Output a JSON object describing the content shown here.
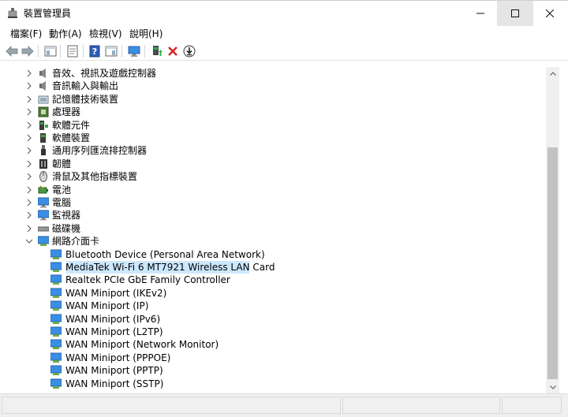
{
  "window": {
    "title": "裝置管理員",
    "icon": "device-manager-icon"
  },
  "menu": [
    {
      "label": "檔案(F)"
    },
    {
      "label": "動作(A)"
    },
    {
      "label": "檢視(V)"
    },
    {
      "label": "說明(H)"
    }
  ],
  "toolbar": [
    {
      "name": "back-button",
      "icon": "arrow-left-icon"
    },
    {
      "name": "forward-button",
      "icon": "arrow-right-icon"
    },
    {
      "name": "show-hide-console-tree-button",
      "icon": "console-tree-icon"
    },
    {
      "name": "properties-button",
      "icon": "properties-icon"
    },
    {
      "name": "help-button",
      "icon": "help-icon"
    },
    {
      "name": "show-action-pane-button",
      "icon": "action-pane-icon"
    },
    {
      "name": "scan-hardware-button",
      "icon": "monitor-scan-icon"
    },
    {
      "name": "update-driver-button",
      "icon": "update-driver-icon"
    },
    {
      "name": "uninstall-device-button",
      "icon": "red-x-icon"
    },
    {
      "name": "download-button",
      "icon": "download-circle-icon"
    }
  ],
  "tree": {
    "categories": [
      {
        "label": "音效、視訊及遊戲控制器",
        "icon": "speaker-icon",
        "expanded": false
      },
      {
        "label": "音訊輸入與輸出",
        "icon": "speaker-icon",
        "expanded": false
      },
      {
        "label": "記憶體技術裝置",
        "icon": "memory-card-icon",
        "expanded": false
      },
      {
        "label": "處理器",
        "icon": "cpu-icon",
        "expanded": false
      },
      {
        "label": "軟體元件",
        "icon": "software-component-icon",
        "expanded": false
      },
      {
        "label": "軟體裝置",
        "icon": "software-device-icon",
        "expanded": false
      },
      {
        "label": "通用序列匯流排控制器",
        "icon": "usb-icon",
        "expanded": false
      },
      {
        "label": "韌體",
        "icon": "firmware-icon",
        "expanded": false
      },
      {
        "label": "滑鼠及其他指標裝置",
        "icon": "mouse-icon",
        "expanded": false
      },
      {
        "label": "電池",
        "icon": "battery-icon",
        "expanded": false
      },
      {
        "label": "電腦",
        "icon": "computer-icon",
        "expanded": false
      },
      {
        "label": "監視器",
        "icon": "monitor-icon",
        "expanded": false
      },
      {
        "label": "磁碟機",
        "icon": "disk-drive-icon",
        "expanded": false
      },
      {
        "label": "網路介面卡",
        "icon": "network-adapter-icon",
        "expanded": true
      }
    ],
    "network_adapters": [
      {
        "label": "Bluetooth Device (Personal Area Network)",
        "selected": false
      },
      {
        "label": "MediaTek Wi-Fi 6 MT7921 Wireless LAN Card",
        "selected": true
      },
      {
        "label": "Realtek PCIe GbE Family Controller",
        "selected": false
      },
      {
        "label": "WAN Miniport (IKEv2)",
        "selected": false
      },
      {
        "label": "WAN Miniport (IP)",
        "selected": false
      },
      {
        "label": "WAN Miniport (IPv6)",
        "selected": false
      },
      {
        "label": "WAN Miniport (L2TP)",
        "selected": false
      },
      {
        "label": "WAN Miniport (Network Monitor)",
        "selected": false
      },
      {
        "label": "WAN Miniport (PPPOE)",
        "selected": false
      },
      {
        "label": "WAN Miniport (PPTP)",
        "selected": false
      },
      {
        "label": "WAN Miniport (SSTP)",
        "selected": false
      }
    ]
  },
  "colors": {
    "selection": "#cce8ff",
    "monitor_blue": "#3a8ee6",
    "uninstall_red": "#d9262c"
  }
}
